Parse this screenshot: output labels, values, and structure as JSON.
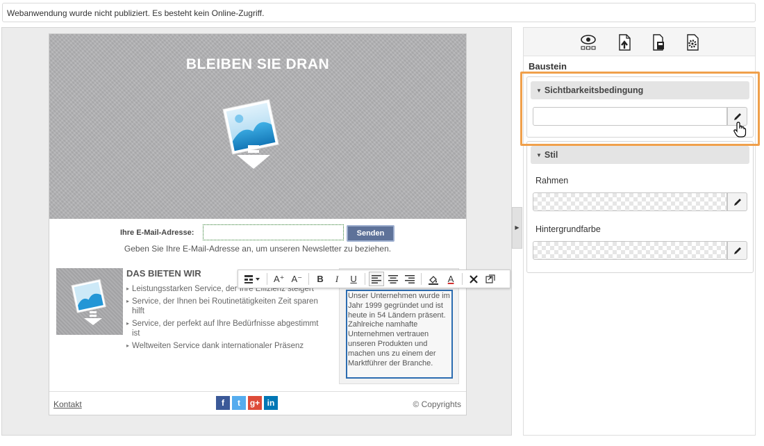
{
  "notice": "Webanwendung wurde nicht publiziert. Es besteht kein Online-Zugriff.",
  "email": {
    "hero_title": "BLEIBEN SIE DRAN",
    "signup_label": "Ihre E-Mail-Adresse:",
    "signup_value": "",
    "send_label": "Senden",
    "signup_help": "Geben Sie Ihre E-Mail-Adresse an, um unseren Newsletter zu beziehen.",
    "offer_title": "DAS BIETEN WIR",
    "offer_items": [
      "Leistungsstarken Service, der Ihre Effizienz steigert",
      "Service, der Ihnen bei Routinetätigkeiten Zeit sparen hilft",
      "Service, der perfekt auf Ihre Bedürfnisse abgestimmt ist",
      "Weltweiten Service dank internationaler Präsenz"
    ],
    "about_text": "Unser Unternehmen wurde im Jahr 1999 gegründet und ist heute in 54 Ländern präsent. Zahlreiche namhafte Unternehmen vertrauen unseren Produkten und machen uns zu einem der Marktführer der Branche.",
    "footer_link": "Kontakt",
    "footer_copy": "© Copyrights",
    "social": [
      "facebook-icon",
      "twitter-icon",
      "google-plus-icon",
      "linkedin-icon"
    ],
    "social_glyphs": [
      "f",
      "t",
      "g+",
      "in"
    ]
  },
  "toolbar": {
    "buttons": [
      "insert-element",
      "font-size-increase",
      "font-size-decrease",
      "bold",
      "italic",
      "underline",
      "align-left",
      "align-center",
      "align-right",
      "highlight-color",
      "text-color",
      "remove-format",
      "source-code"
    ],
    "glyphs": {
      "increase": "A⁺",
      "decrease": "A⁻",
      "bold": "B",
      "italic": "I",
      "underline": "U",
      "text_color": "A"
    }
  },
  "panel": {
    "icons": [
      "eye-icon",
      "export-document-icon",
      "clipboard-document-icon",
      "document-settings-icon"
    ],
    "baustein_label": "Baustein",
    "section_visibility": "Sichtbarkeitsbedingung",
    "section_style": "Stil",
    "rahmen_label": "Rahmen",
    "hintergrund_label": "Hintergrundfarbe"
  },
  "colors": {
    "highlight_border": "#f0a04b",
    "send_button": "#5e7299",
    "text_area_border": "#2b6cb0",
    "facebook": "#3b5998",
    "twitter": "#55acee",
    "googleplus": "#dd4b39",
    "linkedin": "#0077b5"
  }
}
